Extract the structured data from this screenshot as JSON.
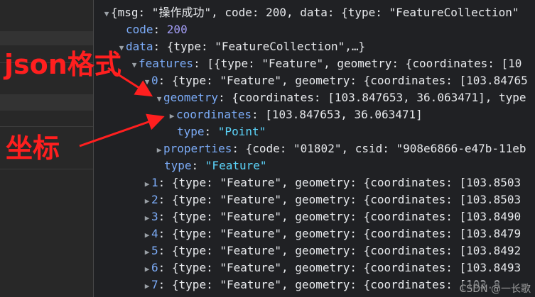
{
  "devtools": {
    "root": {
      "open": "{",
      "preview": "msg: \"操作成功\", code: 200, data: {type: \"FeatureCollection\""
    },
    "code": {
      "key": "code",
      "value": "200"
    },
    "data": {
      "key": "data",
      "preview": "{type: \"FeatureCollection\",…}"
    },
    "features": {
      "key": "features",
      "preview": "[{type: \"Feature\", geometry: {coordinates: [10"
    },
    "feature0": {
      "key": "0",
      "preview": "{type: \"Feature\", geometry: {coordinates: [103.84765",
      "geometry": {
        "key": "geometry",
        "preview": "{coordinates: [103.847653, 36.063471], type"
      },
      "coordinates": {
        "key": "coordinates",
        "value": "[103.847653, 36.063471]"
      },
      "geom_type": {
        "key": "type",
        "value": "\"Point\""
      },
      "properties": {
        "key": "properties",
        "preview": "{code: \"01802\", csid: \"908e6866-e47b-11eb"
      },
      "type": {
        "key": "type",
        "value": "\"Feature\""
      }
    },
    "feature_rows": [
      {
        "key": "1",
        "preview": "{type: \"Feature\", geometry: {coordinates: [103.8503"
      },
      {
        "key": "2",
        "preview": "{type: \"Feature\", geometry: {coordinates: [103.8503"
      },
      {
        "key": "3",
        "preview": "{type: \"Feature\", geometry: {coordinates: [103.8490"
      },
      {
        "key": "4",
        "preview": "{type: \"Feature\", geometry: {coordinates: [103.8479"
      },
      {
        "key": "5",
        "preview": "{type: \"Feature\", geometry: {coordinates: [103.8492"
      },
      {
        "key": "6",
        "preview": "{type: \"Feature\", geometry: {coordinates: [103.8493"
      },
      {
        "key": "7",
        "preview": "{type: \"Feature\", geometry: {coordinates: [103.8"
      }
    ]
  },
  "annotations": {
    "json_label": "json格式",
    "coord_label": "坐标"
  },
  "watermark": "CSDN @一长歌",
  "colors": {
    "background": "#202124",
    "key": "#7cacf8",
    "string": "#5cd5fb",
    "number": "#a39df6",
    "annotation": "#ff1f1f"
  }
}
